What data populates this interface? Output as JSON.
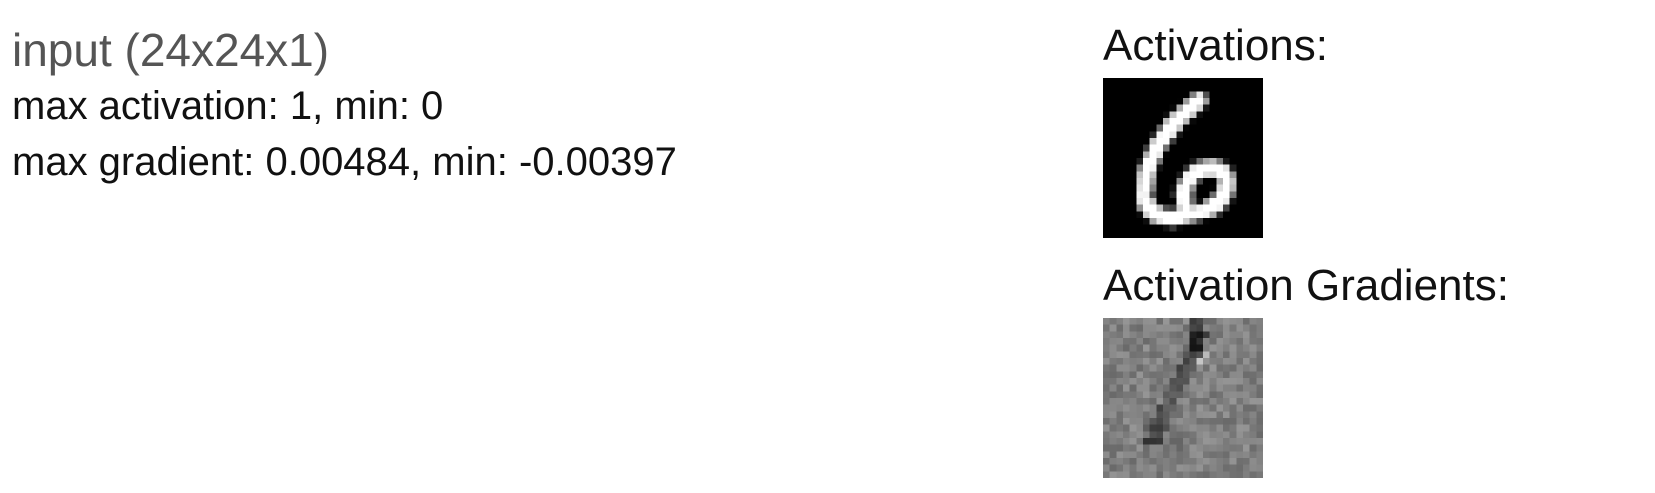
{
  "layer": {
    "title": "input (24x24x1)",
    "activation_stats": "max activation: 1, min: 0",
    "gradient_stats": "max gradient: 0.00484, min: -0.00397"
  },
  "panels": {
    "activations_label": "Activations:",
    "gradients_label": "Activation Gradients:"
  },
  "colors": {
    "activation_background": "#000000",
    "activation_foreground": "#ffffff",
    "gradient_midtone": "#808080"
  }
}
